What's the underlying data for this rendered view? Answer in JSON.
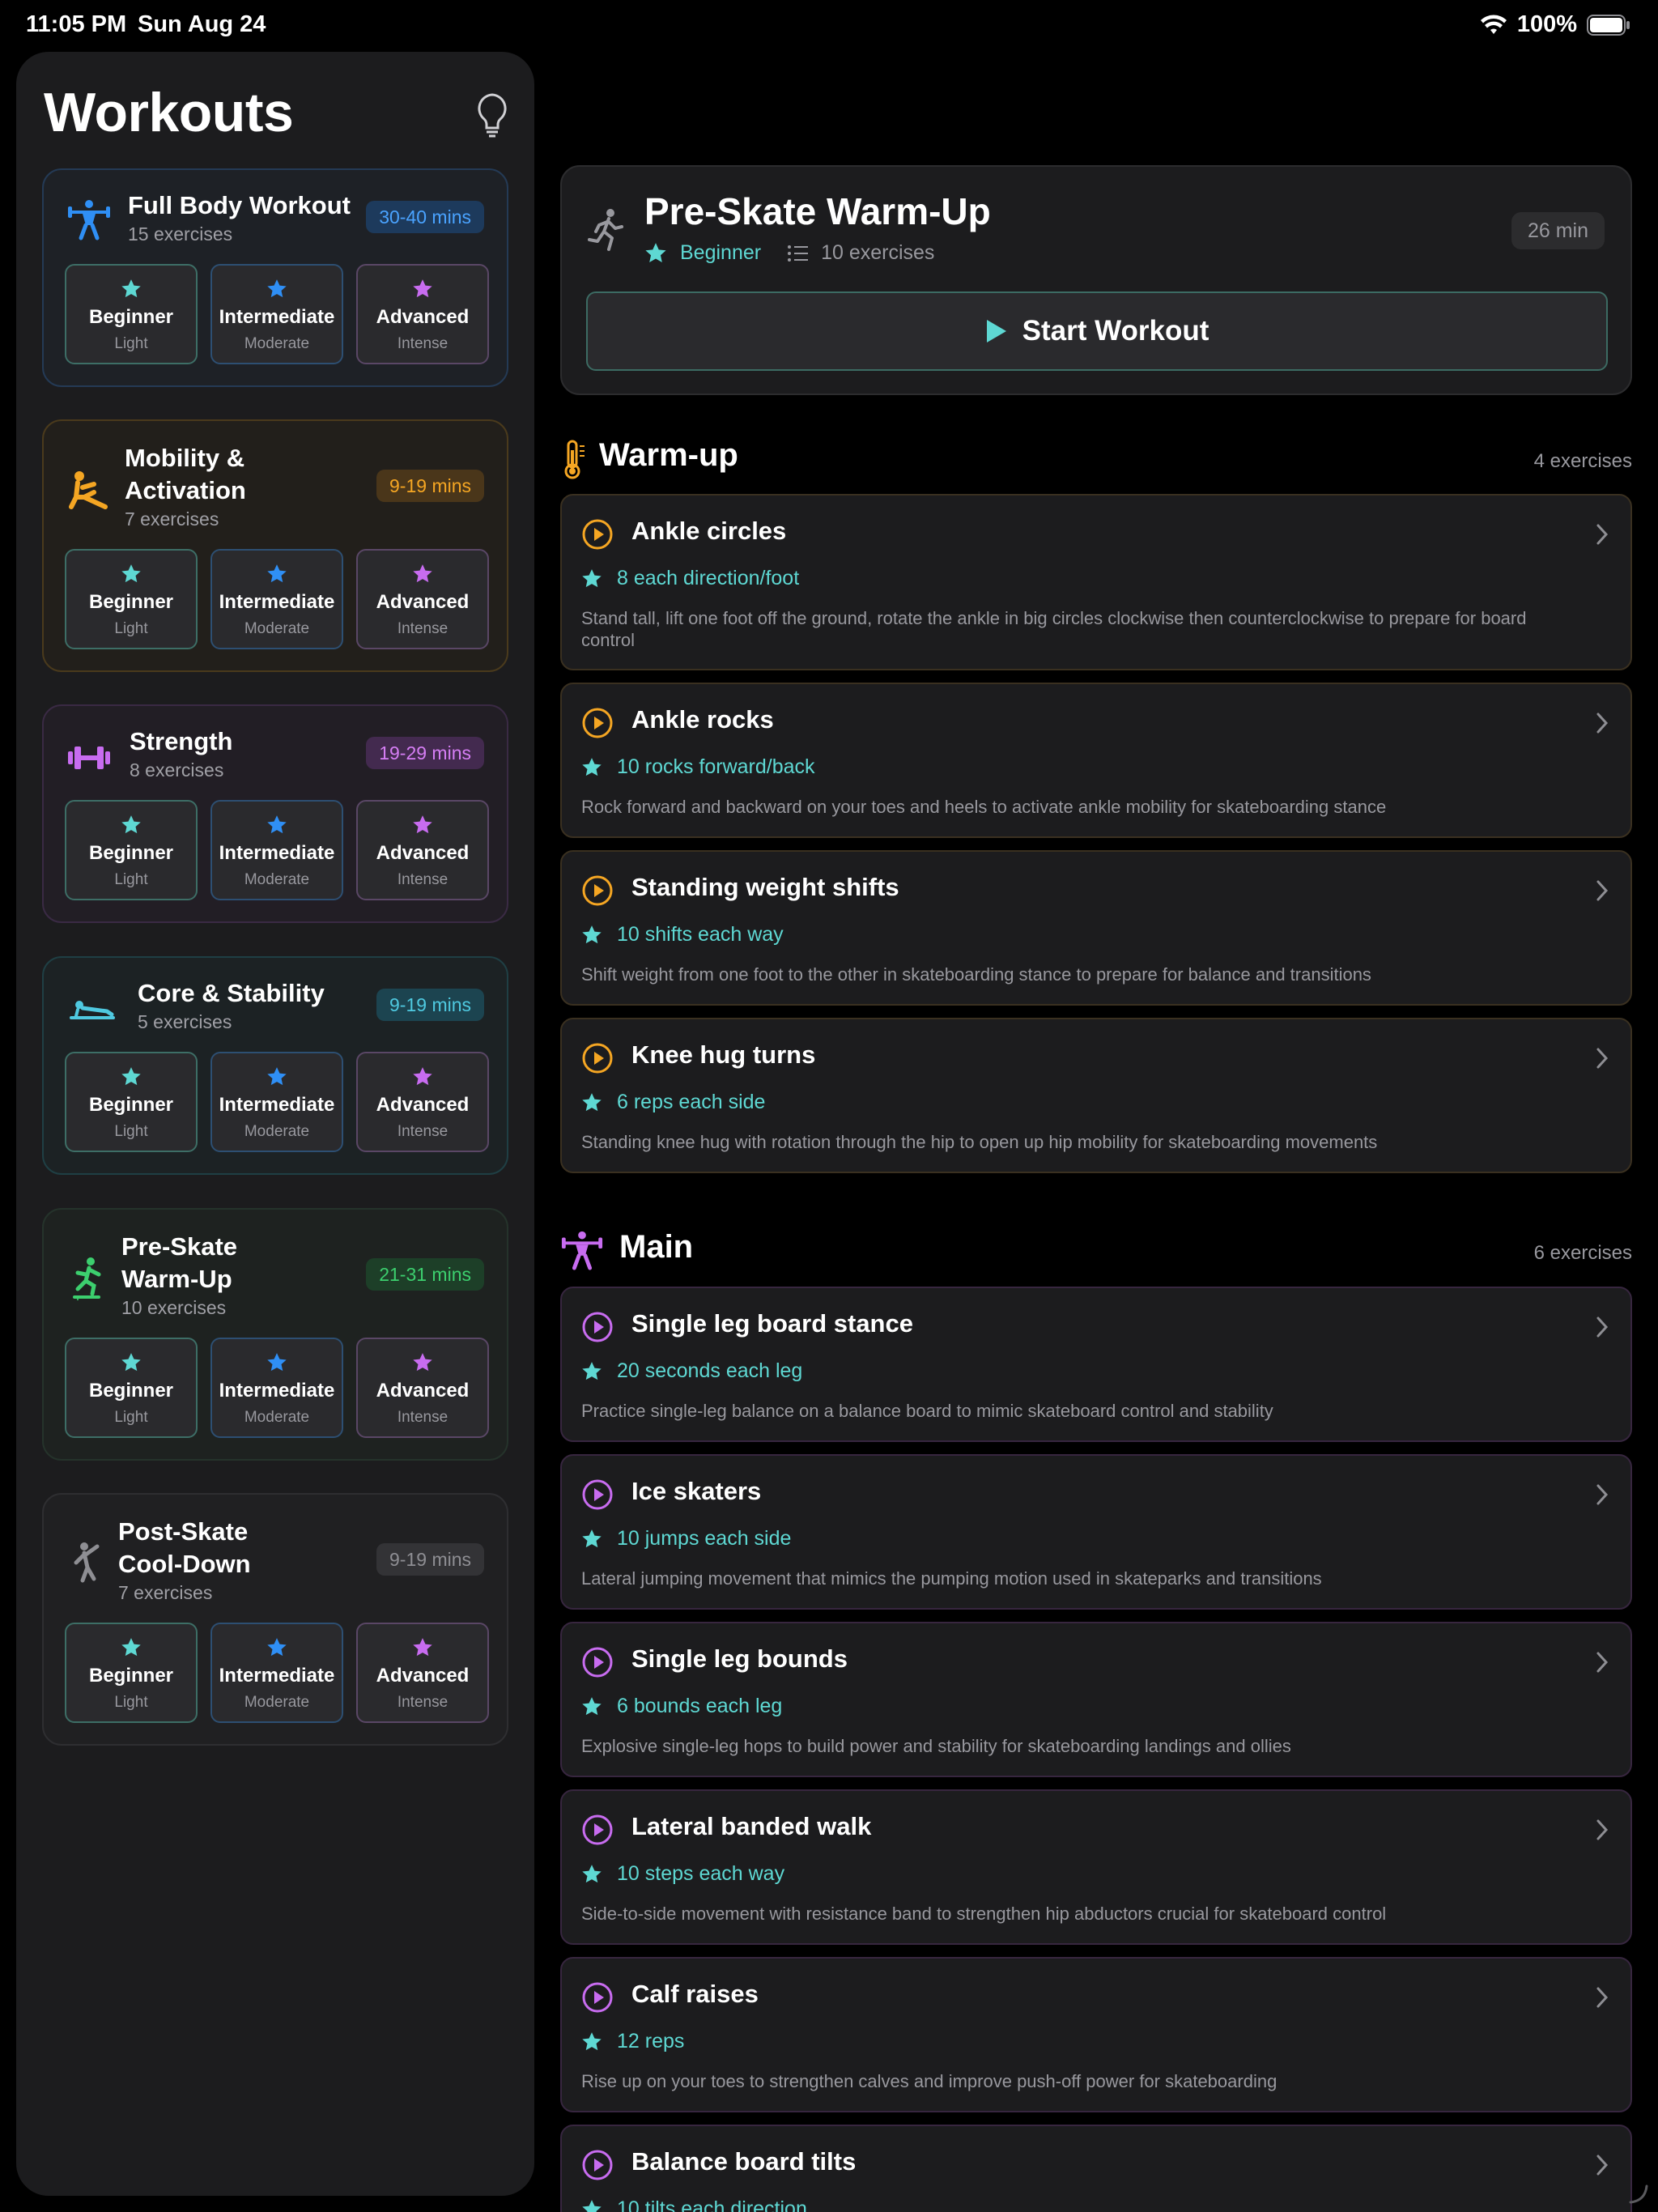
{
  "status": {
    "time": "11:05 PM",
    "date": "Sun Aug 24",
    "battery": "100%"
  },
  "sidebar": {
    "title": "Workouts",
    "workouts": [
      {
        "title": "Full Body Workout",
        "subtitle": "15 exercises",
        "duration": "30-40 mins",
        "icon": "weightlifter-icon",
        "color": "#2f8ff5"
      },
      {
        "title": "Mobility & Activation",
        "title_l1": "Mobility &",
        "title_l2": "Activation",
        "subtitle": "7 exercises",
        "duration": "9-19 mins",
        "icon": "stretch-icon",
        "color": "#f5a623"
      },
      {
        "title": "Strength",
        "subtitle": "8 exercises",
        "duration": "19-29 mins",
        "icon": "dumbbell-icon",
        "color": "#c86cf0"
      },
      {
        "title": "Core & Stability",
        "subtitle": "5 exercises",
        "duration": "9-19 mins",
        "icon": "plank-icon",
        "color": "#4fc9e0"
      },
      {
        "title": "Pre-Skate Warm-Up",
        "title_l1": "Pre-Skate",
        "title_l2": "Warm-Up",
        "subtitle": "10 exercises",
        "duration": "21-31 mins",
        "icon": "skater-icon",
        "color": "#3ccf6e"
      },
      {
        "title": "Post-Skate Cool-Down",
        "title_l1": "Post-Skate",
        "title_l2": "Cool-Down",
        "subtitle": "7 exercises",
        "duration": "9-19 mins",
        "icon": "cooldown-icon",
        "color": "#8e8e93"
      }
    ],
    "levels": [
      {
        "name": "Beginner",
        "intensity": "Light",
        "star_color": "#5ed8d3"
      },
      {
        "name": "Intermediate",
        "intensity": "Moderate",
        "star_color": "#2f8ff5"
      },
      {
        "name": "Advanced",
        "intensity": "Intense",
        "star_color": "#c86cf0"
      }
    ]
  },
  "detail": {
    "title": "Pre-Skate Warm-Up",
    "level": "Beginner",
    "exercise_count": "10 exercises",
    "duration": "26 min",
    "start_label": "Start Workout",
    "sections": [
      {
        "title": "Warm-up",
        "count": "4 exercises",
        "icon": "thermometer-icon",
        "color": "#f5a623",
        "exercises": [
          {
            "name": "Ankle circles",
            "reps": "8 each direction/foot",
            "description": "Stand tall, lift one foot off the ground, rotate the ankle in big circles clockwise then counterclockwise to prepare for board control"
          },
          {
            "name": "Ankle rocks",
            "reps": "10 rocks forward/back",
            "description": "Rock forward and backward on your toes and heels to activate ankle mobility for skateboarding stance"
          },
          {
            "name": "Standing weight shifts",
            "reps": "10 shifts each way",
            "description": "Shift weight from one foot to the other in skateboarding stance to prepare for balance and transitions"
          },
          {
            "name": "Knee hug turns",
            "reps": "6 reps each side",
            "description": "Standing knee hug with rotation through the hip to open up hip mobility for skateboarding movements"
          }
        ]
      },
      {
        "title": "Main",
        "count": "6 exercises",
        "icon": "weightlifter-icon",
        "color": "#c86cf0",
        "exercises": [
          {
            "name": "Single leg board stance",
            "reps": "20 seconds each leg",
            "description": "Practice single-leg balance on a balance board to mimic skateboard control and stability"
          },
          {
            "name": "Ice skaters",
            "reps": "10 jumps each side",
            "description": "Lateral jumping movement that mimics the pumping motion used in skateparks and transitions"
          },
          {
            "name": "Single leg bounds",
            "reps": "6 bounds each leg",
            "description": "Explosive single-leg hops to build power and stability for skateboarding landings and ollies"
          },
          {
            "name": "Lateral banded walk",
            "reps": "10 steps each way",
            "description": "Side-to-side movement with resistance band to strengthen hip abductors crucial for skateboard control"
          },
          {
            "name": "Calf raises",
            "reps": "12 reps",
            "description": "Rise up on your toes to strengthen calves and improve push-off power for skateboarding"
          },
          {
            "name": "Balance board tilts",
            "reps": "10 tilts each direction",
            "description": ""
          }
        ]
      }
    ]
  }
}
